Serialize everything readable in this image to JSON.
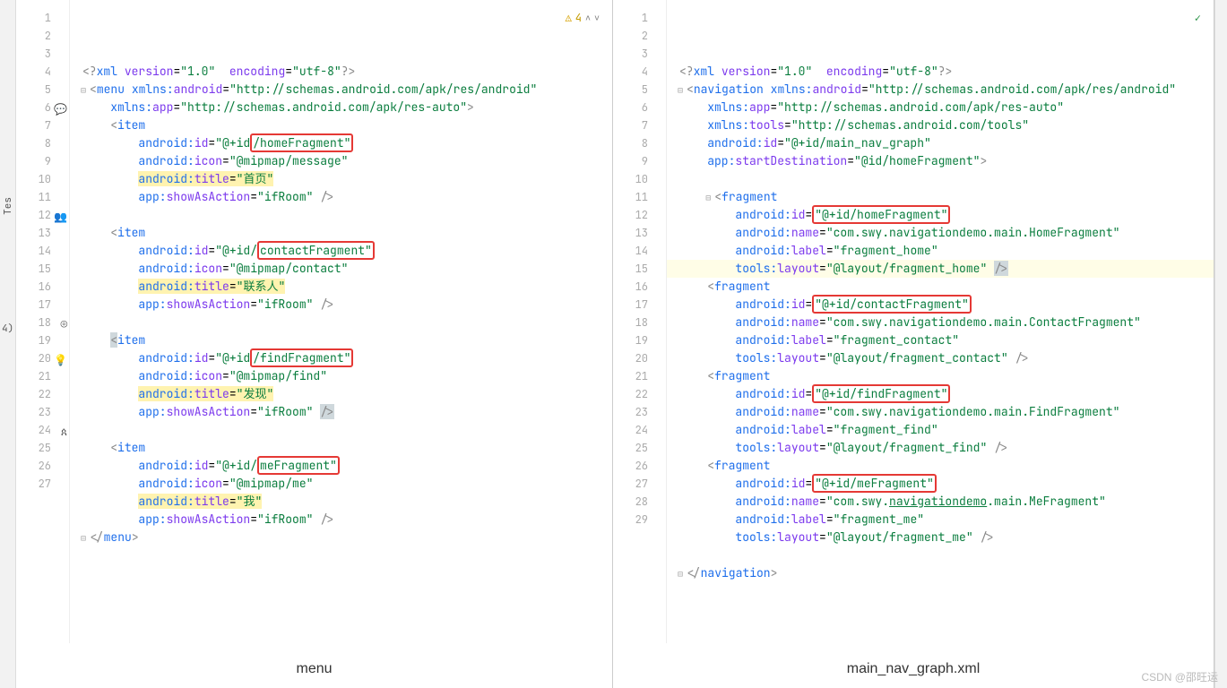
{
  "left": {
    "warn_count": "4",
    "caption": "menu",
    "lines": [
      {
        "n": 1,
        "html": "<span class='t-punc'>&lt;?</span><span class='t-tag'>xml</span> <span class='t-attr'>version</span>=<span class='t-val'>\"1.0\"</span>  <span class='t-attr'>encoding</span>=<span class='t-val'>\"utf-8\"</span><span class='t-punc'>?&gt;</span>"
      },
      {
        "n": 2,
        "html": "<span class='folding'>⊟</span><span class='t-punc'>&lt;</span><span class='t-tag'>menu</span> <span class='t-ns'>xmlns:</span><span class='t-attr'>android</span>=<span class='t-val'>\"http://schemas.android.com/apk/res/android\"</span>"
      },
      {
        "n": 3,
        "html": "    <span class='t-ns'>xmlns:</span><span class='t-attr'>app</span>=<span class='t-val'>\"http://schemas.android.com/apk/res-auto\"</span><span class='t-punc'>&gt;</span>"
      },
      {
        "n": 4,
        "html": "    <span class='t-punc'>&lt;</span><span class='t-tag'>item</span>"
      },
      {
        "n": 5,
        "html": "        <span class='t-ns'>android:</span><span class='t-attr'>id</span>=<span class='t-val'>\"@+id</span><span class='boxred'><span class='t-val'>/homeFragment\"</span></span>"
      },
      {
        "n": 6,
        "icon": "💬",
        "html": "        <span class='t-ns'>android:</span><span class='t-attr'>icon</span>=<span class='t-val'>\"@mipmap/message\"</span>"
      },
      {
        "n": 7,
        "html": "        <span class='t-hl'><span class='t-ns'>android:</span><span class='t-attr'>title</span>=<span class='t-val'>\"首页\"</span></span>"
      },
      {
        "n": 8,
        "html": "        <span class='t-ns'>app:</span><span class='t-attr'>showAsAction</span>=<span class='t-val'>\"ifRoom\"</span> <span class='t-punc'>/&gt;</span>"
      },
      {
        "n": 9,
        "html": ""
      },
      {
        "n": 10,
        "html": "    <span class='t-punc'>&lt;</span><span class='t-tag'>item</span>"
      },
      {
        "n": 11,
        "html": "        <span class='t-ns'>android:</span><span class='t-attr'>id</span>=<span class='t-val'>\"@+id/</span><span class='boxred'><span class='t-val'>contactFragment\"</span></span>"
      },
      {
        "n": 12,
        "icon": "👥",
        "html": "        <span class='t-ns'>android:</span><span class='t-attr'>icon</span>=<span class='t-val'>\"@mipmap/contact\"</span>"
      },
      {
        "n": 13,
        "html": "        <span class='t-hl'><span class='t-ns'>android:</span><span class='t-attr'>title</span>=<span class='t-val'>\"联系人\"</span></span>"
      },
      {
        "n": 14,
        "html": "        <span class='t-ns'>app:</span><span class='t-attr'>showAsAction</span>=<span class='t-val'>\"ifRoom\"</span> <span class='t-punc'>/&gt;</span>"
      },
      {
        "n": 15,
        "html": ""
      },
      {
        "n": 16,
        "html": "    <span class='t-caret'><span class='t-punc'>&lt;</span></span><span class='t-tag'>item</span>"
      },
      {
        "n": 17,
        "html": "        <span class='t-ns'>android:</span><span class='t-attr'>id</span>=<span class='t-val'>\"@+id</span><span class='boxred'><span class='t-val'>/findFragment\"</span></span>"
      },
      {
        "n": 18,
        "icon": "◎",
        "html": "        <span class='t-ns'>android:</span><span class='t-attr'>icon</span>=<span class='t-val'>\"@mipmap/find\"</span>"
      },
      {
        "n": 19,
        "html": "        <span class='t-hl'><span class='t-ns'>android:</span><span class='t-attr'>title</span>=<span class='t-val'>\"发现\"</span></span>"
      },
      {
        "n": 20,
        "icon": "💡",
        "cls": "bulb",
        "html": "        <span class='t-ns'>app:</span><span class='t-attr'>showAsAction</span>=<span class='t-val'>\"ifRoom\"</span> <span class='t-caret'><span class='t-punc'>/&gt;</span></span>"
      },
      {
        "n": 21,
        "html": ""
      },
      {
        "n": 22,
        "html": "    <span class='t-punc'>&lt;</span><span class='t-tag'>item</span>"
      },
      {
        "n": 23,
        "html": "        <span class='t-ns'>android:</span><span class='t-attr'>id</span>=<span class='t-val'>\"@+id/</span><span class='boxred'><span class='t-val'>meFragment\"</span></span>"
      },
      {
        "n": 24,
        "icon": "ጰ",
        "html": "        <span class='t-ns'>android:</span><span class='t-attr'>icon</span>=<span class='t-val'>\"@mipmap/me\"</span>"
      },
      {
        "n": 25,
        "html": "        <span class='t-hl'><span class='t-ns'>android:</span><span class='t-attr'>title</span>=<span class='t-val'>\"我\"</span></span>"
      },
      {
        "n": 26,
        "html": "        <span class='t-ns'>app:</span><span class='t-attr'>showAsAction</span>=<span class='t-val'>\"ifRoom\"</span> <span class='t-punc'>/&gt;</span>"
      },
      {
        "n": 27,
        "html": "<span class='folding'>⊟</span><span class='t-punc'>&lt;/</span><span class='t-tag'>menu</span><span class='t-punc'>&gt;</span>"
      }
    ]
  },
  "right": {
    "caption": "main_nav_graph.xml",
    "lines": [
      {
        "n": 1,
        "html": "<span class='t-punc'>&lt;?</span><span class='t-tag'>xml</span> <span class='t-attr'>version</span>=<span class='t-val'>\"1.0\"</span>  <span class='t-attr'>encoding</span>=<span class='t-val'>\"utf-8\"</span><span class='t-punc'>?&gt;</span>"
      },
      {
        "n": 2,
        "html": "<span class='folding'>⊟</span><span class='t-punc'>&lt;</span><span class='t-tag'>navigation</span> <span class='t-ns'>xmlns:</span><span class='t-attr'>android</span>=<span class='t-val'>\"http://schemas.android.com/apk/res/android\"</span>"
      },
      {
        "n": 3,
        "html": "    <span class='t-ns'>xmlns:</span><span class='t-attr'>app</span>=<span class='t-val'>\"http://schemas.android.com/apk/res-auto\"</span>"
      },
      {
        "n": 4,
        "html": "    <span class='t-ns'>xmlns:</span><span class='t-attr'>tools</span>=<span class='t-val'>\"http://schemas.android.com/tools\"</span>"
      },
      {
        "n": 5,
        "html": "    <span class='t-ns'>android:</span><span class='t-attr'>id</span>=<span class='t-val'>\"@+id/main_nav_graph\"</span>"
      },
      {
        "n": 6,
        "html": "    <span class='t-ns'>app:</span><span class='t-attr'>startDestination</span>=<span class='t-val'>\"@id/homeFragment\"</span><span class='t-punc'>&gt;</span>"
      },
      {
        "n": 7,
        "html": ""
      },
      {
        "n": 8,
        "html": "    <span class='folding'>⊟</span><span class='t-punc'>&lt;</span><span class='t-tag'>fragment</span>"
      },
      {
        "n": 9,
        "html": "        <span class='t-ns'>android:</span><span class='t-attr'>id</span>=<span class='boxred'><span class='t-val'>\"@+id/homeFragment\"</span></span>"
      },
      {
        "n": 10,
        "html": "        <span class='t-ns'>android:</span><span class='t-attr'>name</span>=<span class='t-val'>\"com.swy.navigationdemo.main.HomeFragment\"</span>"
      },
      {
        "n": 11,
        "html": "        <span class='t-ns'>android:</span><span class='t-attr'>label</span>=<span class='t-val'>\"fragment_home\"</span>"
      },
      {
        "n": 12,
        "hl": true,
        "html": "        <span class='t-ns'>tools:</span><span class='t-attr'>layout</span>=<span class='t-val'>\"@layout/fragment_home\"</span> <span class='t-caret'><span class='t-punc'>/&gt;</span></span>"
      },
      {
        "n": 13,
        "html": "    <span class='t-punc'>&lt;</span><span class='t-tag'>fragment</span>"
      },
      {
        "n": 14,
        "html": "        <span class='t-ns'>android:</span><span class='t-attr'>id</span>=<span class='boxred'><span class='t-val'>\"@+id/contactFragment\"</span></span>"
      },
      {
        "n": 15,
        "html": "        <span class='t-ns'>android:</span><span class='t-attr'>name</span>=<span class='t-val'>\"com.swy.navigationdemo.main.ContactFragment\"</span>"
      },
      {
        "n": 16,
        "html": "        <span class='t-ns'>android:</span><span class='t-attr'>label</span>=<span class='t-val'>\"fragment_contact\"</span>"
      },
      {
        "n": 17,
        "html": "        <span class='t-ns'>tools:</span><span class='t-attr'>layout</span>=<span class='t-val'>\"@layout/fragment_contact\"</span> <span class='t-punc'>/&gt;</span>"
      },
      {
        "n": 18,
        "html": "    <span class='t-punc'>&lt;</span><span class='t-tag'>fragment</span>"
      },
      {
        "n": 19,
        "html": "        <span class='t-ns'>android:</span><span class='t-attr'>id</span>=<span class='boxred'><span class='t-val'>\"@+id/findFragment\"</span></span>"
      },
      {
        "n": 20,
        "html": "        <span class='t-ns'>android:</span><span class='t-attr'>name</span>=<span class='t-val'>\"com.swy.navigationdemo.main.FindFragment\"</span>"
      },
      {
        "n": 21,
        "html": "        <span class='t-ns'>android:</span><span class='t-attr'>label</span>=<span class='t-val'>\"fragment_find\"</span>"
      },
      {
        "n": 22,
        "html": "        <span class='t-ns'>tools:</span><span class='t-attr'>layout</span>=<span class='t-val'>\"@layout/fragment_find\"</span> <span class='t-punc'>/&gt;</span>"
      },
      {
        "n": 23,
        "html": "    <span class='t-punc'>&lt;</span><span class='t-tag'>fragment</span>"
      },
      {
        "n": 24,
        "html": "        <span class='t-ns'>android:</span><span class='t-attr'>id</span>=<span class='boxred'><span class='t-val'>\"@+id/meFragment\"</span></span>"
      },
      {
        "n": 25,
        "html": "        <span class='t-ns'>android:</span><span class='t-attr'>name</span>=<span class='t-val'>\"com.swy.<u>navigationdemo</u>.main.MeFragment\"</span>"
      },
      {
        "n": 26,
        "html": "        <span class='t-ns'>android:</span><span class='t-attr'>label</span>=<span class='t-val'>\"fragment_me\"</span>"
      },
      {
        "n": 27,
        "html": "        <span class='t-ns'>tools:</span><span class='t-attr'>layout</span>=<span class='t-val'>\"@layout/fragment_me\"</span> <span class='t-punc'>/&gt;</span>"
      },
      {
        "n": 28,
        "html": ""
      },
      {
        "n": 29,
        "html": "<span class='folding'>⊟</span><span class='t-punc'>&lt;/</span><span class='t-tag'>navigation</span><span class='t-punc'>&gt;</span>"
      }
    ]
  },
  "watermark": "CSDN @邵旺运",
  "side": {
    "tes": "Tes",
    "four": "4)"
  }
}
